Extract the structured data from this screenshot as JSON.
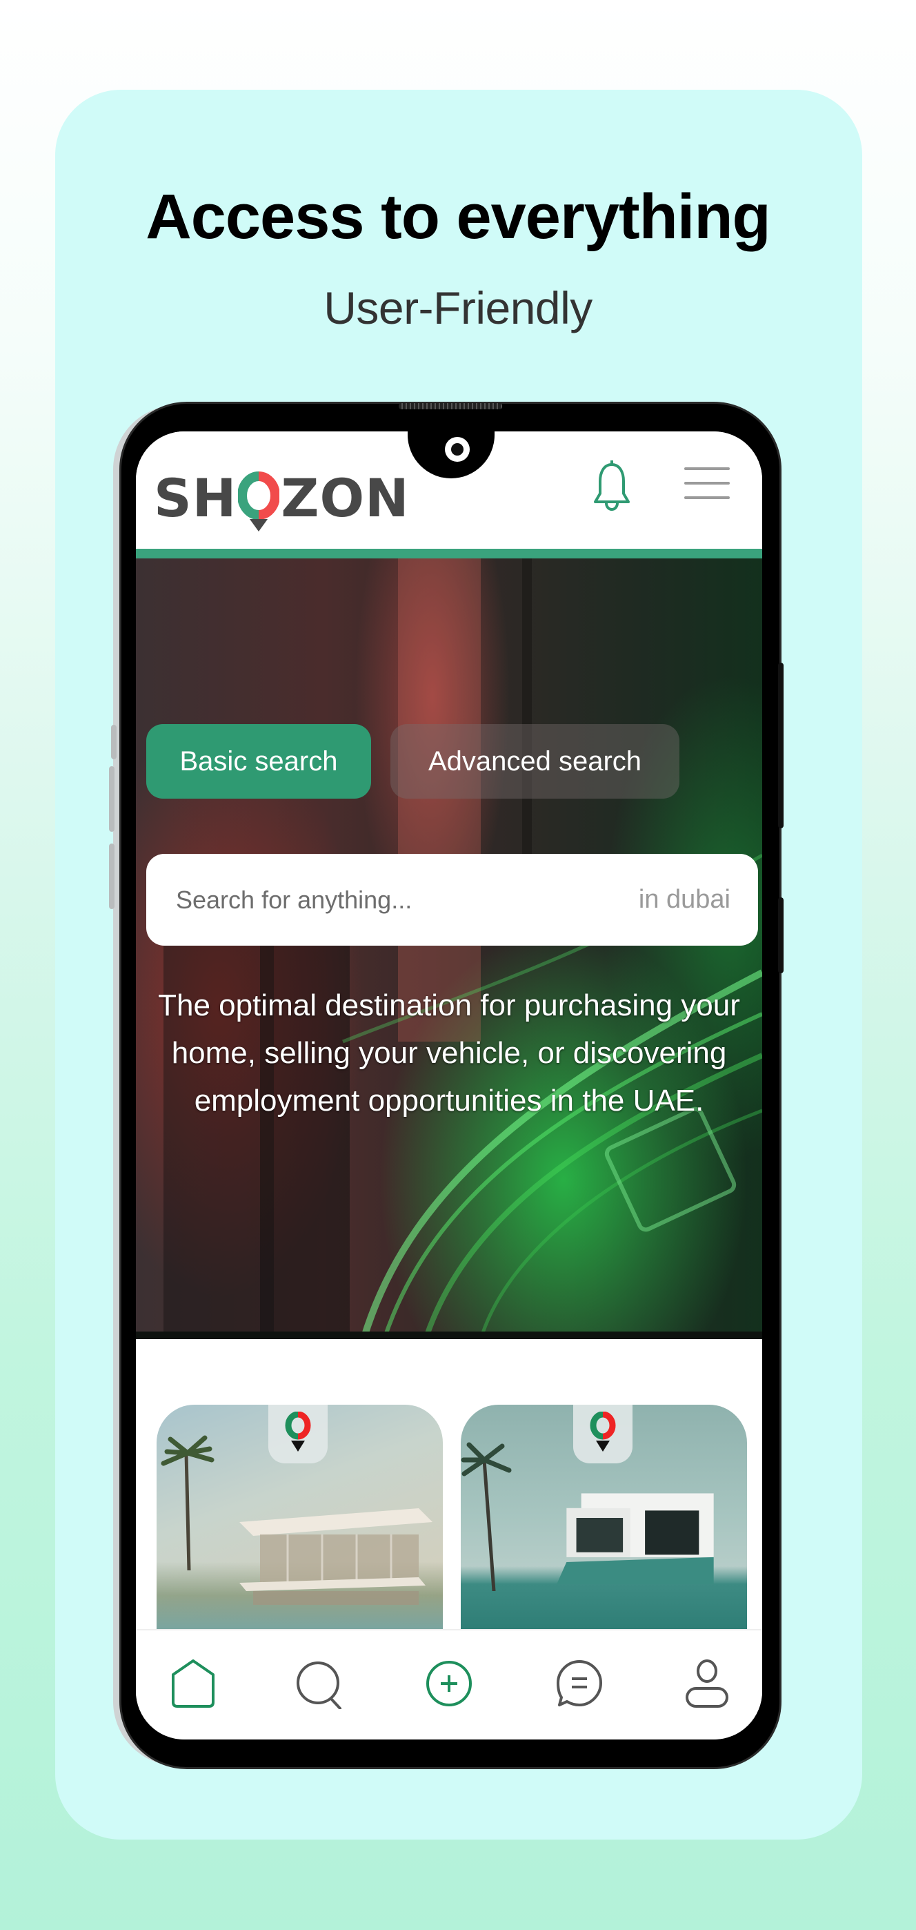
{
  "promo": {
    "headline": "Access to everything",
    "subheadline": "User-Friendly"
  },
  "app": {
    "brand": {
      "name_left": "SH",
      "name_right": "ZON",
      "full_name": "SHOZON",
      "colors": {
        "green": "#3aa37d",
        "red": "#f14b4b",
        "dark": "#484848"
      }
    },
    "header": {
      "notification_icon": "bell-icon",
      "menu_icon": "hamburger-menu-icon"
    },
    "search": {
      "tabs": [
        {
          "label": "Basic search",
          "active": true
        },
        {
          "label": "Advanced search",
          "active": false
        }
      ],
      "placeholder": "Search for anything...",
      "location": "in dubai"
    },
    "tagline": "The optimal destination for purchasing your home, selling your vehicle, or discovering employment opportunities in the UAE.",
    "listings": [
      {
        "image": "modern-villa-with-palm-tree",
        "badge_icon": "shozon-pin-icon"
      },
      {
        "image": "white-villa-with-pool",
        "badge_icon": "shozon-pin-icon"
      }
    ],
    "bottom_nav": [
      {
        "name": "home",
        "icon": "home-icon",
        "active": true
      },
      {
        "name": "search",
        "icon": "search-icon",
        "active": false
      },
      {
        "name": "add",
        "icon": "add-circle-icon",
        "active": false,
        "accent": true
      },
      {
        "name": "messages",
        "icon": "chat-icon",
        "active": false
      },
      {
        "name": "profile",
        "icon": "user-icon",
        "active": false
      }
    ],
    "accent_color": "#2f9a72"
  }
}
